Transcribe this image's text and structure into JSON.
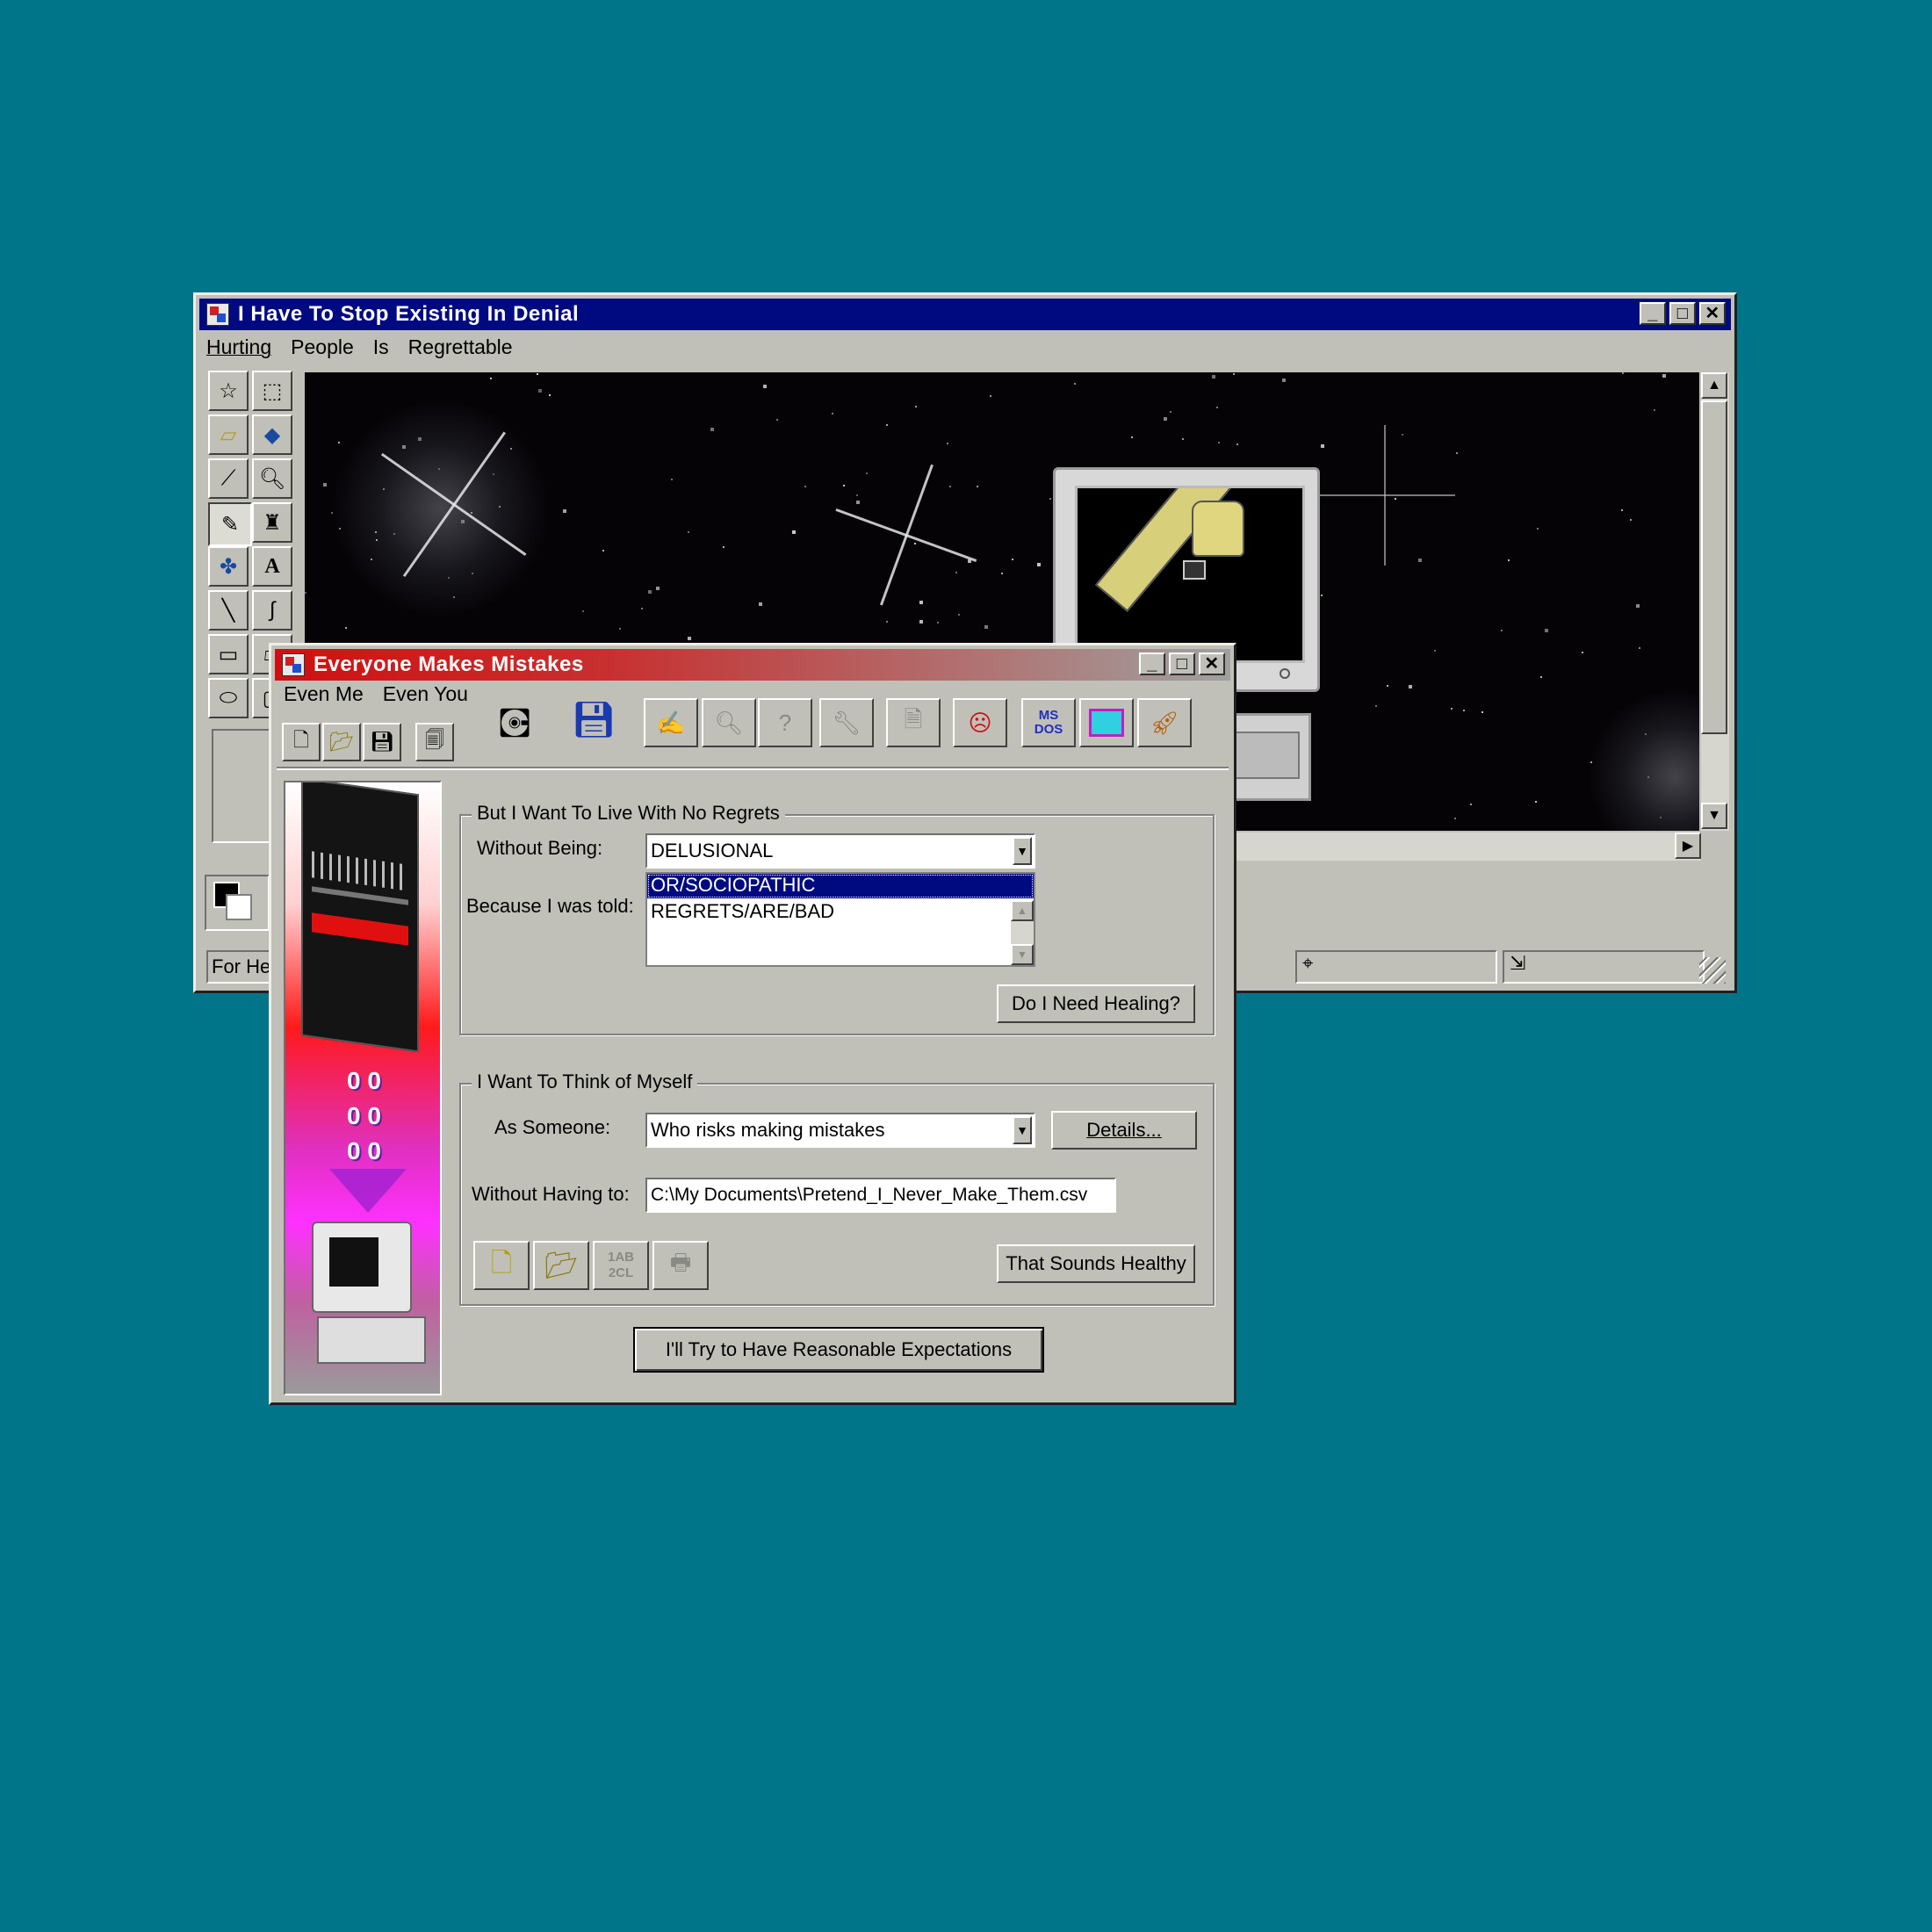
{
  "colors": {
    "desktop": "#00758a",
    "title_active": "#000a80",
    "title_grad_start": "#d01010",
    "title_grad_end": "#a0a0a0",
    "selection": "#000a80"
  },
  "back_window": {
    "title": "I Have To Stop Existing In Denial",
    "menu": [
      "Hurting",
      "People",
      "Is",
      "Regrettable"
    ],
    "tools": [
      "free-select-icon",
      "rect-select-icon",
      "eraser-icon",
      "fill-icon",
      "eyedropper-icon",
      "magnifier-icon",
      "pencil-icon",
      "brush-icon",
      "airbrush-icon",
      "text-icon",
      "line-icon",
      "curve-icon",
      "rectangle-icon",
      "polygon-icon",
      "ellipse-icon",
      "rounded-rect-icon"
    ],
    "status_text": "For He"
  },
  "dialog": {
    "title": "Everyone Makes Mistakes",
    "menu": [
      "Even Me",
      "Even You"
    ],
    "group1": {
      "legend": "But I Want To Live With No Regrets",
      "without_being_label": "Without Being:",
      "without_being_value": "DELUSIONAL",
      "because_label": "Because I was told:",
      "list_items": [
        "OR/SOCIOPATHIC",
        "REGRETS/ARE/BAD"
      ],
      "healing_button": "Do I Need Healing?"
    },
    "group2": {
      "legend": "I Want To Think of Myself",
      "as_someone_label": "As Someone:",
      "as_someone_value": "Who risks making mistakes",
      "details_button": "Details...",
      "without_having_label": "Without Having to:",
      "without_having_value": "C:\\My Documents\\Pretend_I_Never_Make_Them.csv",
      "healthy_button": "That Sounds Healthy",
      "mini_icon_text": "1AB 2CL"
    },
    "ok_button": "I'll Try to Have Reasonable Expectations",
    "toolbar_ms_text": "MS DOS",
    "illustration_digits": [
      "0",
      "0",
      "0",
      "0",
      "0",
      "0"
    ]
  }
}
